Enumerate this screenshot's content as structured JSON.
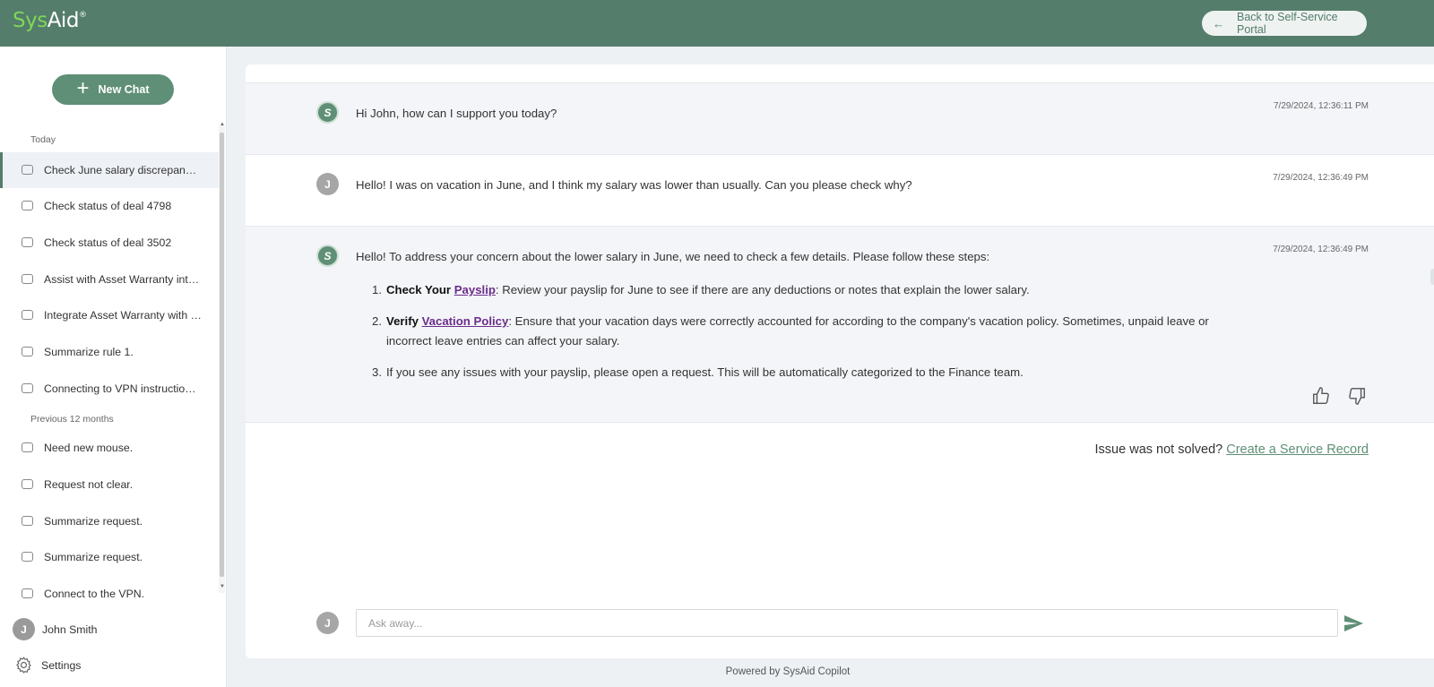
{
  "brand": {
    "logo_left": "Sys",
    "logo_right": "Aid",
    "logo_mark": "®"
  },
  "header": {
    "back_label": "Back to Self-Service Portal",
    "back_icon": "arrow-left-icon"
  },
  "sidebar": {
    "new_chat_label": "New Chat",
    "sections": [
      {
        "label": "Today",
        "items": [
          "Check June salary discrepancy,...",
          "Check status of deal 4798",
          "Check status of deal 3502",
          "Assist with Asset Warranty inte...",
          "Integrate Asset Warranty with S...",
          "Summarize rule 1.",
          "Connecting to VPN instructions..."
        ]
      },
      {
        "label": "Previous 12 months",
        "items": [
          "Need new mouse.",
          "Request not clear.",
          "Summarize request.",
          "Summarize request.",
          "Connect to the VPN."
        ]
      }
    ],
    "user": {
      "initial": "J",
      "name": "John Smith"
    },
    "settings_label": "Settings"
  },
  "chat": {
    "bot_initial": "S",
    "user_initial": "J",
    "messages": [
      {
        "role": "bot",
        "text": "Hi John, how can I support you today?",
        "timestamp": "7/29/2024, 12:36:11 PM"
      },
      {
        "role": "user",
        "text": "Hello! I was on vacation in June, and I think my salary was lower than usually. Can you please check why?",
        "timestamp": "7/29/2024, 12:36:49 PM"
      },
      {
        "role": "bot",
        "text": "Hello! To address your concern about the lower salary in June, we need to check a few details. Please follow these steps:",
        "timestamp": "7/29/2024, 12:36:49 PM",
        "steps": [
          {
            "num": "1.",
            "bold": "Check Your ",
            "link": "Payslip",
            "rest": ": Review your payslip for June to see if there are any deductions or notes that explain the lower salary."
          },
          {
            "num": "2.",
            "bold": "Verify ",
            "link": "Vacation Policy",
            "rest": ": Ensure that your vacation days were correctly accounted for according to the company's vacation policy. Sometimes, unpaid leave or incorrect leave entries can affect your salary."
          },
          {
            "num": "3.",
            "bold": "",
            "link": "",
            "rest": "If you see any issues with your payslip, please open a request. This will be automatically categorized to the Finance team."
          }
        ]
      }
    ],
    "not_solved_text": "Issue was not solved? ",
    "create_record_label": "Create a Service Record",
    "input_placeholder": "Ask away..."
  },
  "footer": "Powered by SysAid Copilot"
}
